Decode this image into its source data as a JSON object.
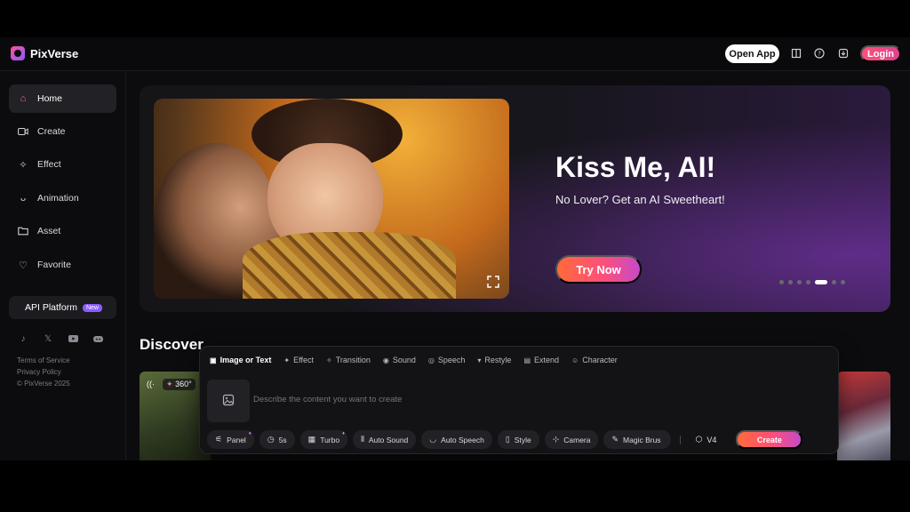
{
  "app": {
    "name": "PixVerse"
  },
  "header": {
    "open_app": "Open App",
    "login": "Login",
    "icons": [
      "book-icon",
      "help-icon",
      "download-icon"
    ]
  },
  "sidebar": {
    "items": [
      {
        "label": "Home",
        "icon": "home-icon",
        "active": true
      },
      {
        "label": "Create",
        "icon": "video-icon"
      },
      {
        "label": "Effect",
        "icon": "sparkle-icon"
      },
      {
        "label": "Animation",
        "icon": "animation-icon"
      },
      {
        "label": "Asset",
        "icon": "folder-icon"
      },
      {
        "label": "Favorite",
        "icon": "heart-icon"
      }
    ],
    "api_platform": {
      "label": "API Platform",
      "badge": "New"
    },
    "socials": [
      "tiktok-icon",
      "x-icon",
      "youtube-icon",
      "discord-icon"
    ],
    "footer": {
      "terms": "Terms of Service",
      "privacy": "Privacy Policy",
      "copyright": "© PixVerse 2025"
    }
  },
  "hero": {
    "title": "Kiss Me, AI!",
    "subtitle": "No Lover? Get an AI Sweetheart!",
    "cta": "Try Now",
    "carousel_count": 7,
    "carousel_active": 4
  },
  "discover": {
    "title": "Discover",
    "first_card_badge": "360°"
  },
  "create_panel": {
    "tabs": [
      {
        "label": "Image or Text",
        "active": true
      },
      {
        "label": "Effect"
      },
      {
        "label": "Transition"
      },
      {
        "label": "Sound"
      },
      {
        "label": "Speech"
      },
      {
        "label": "Restyle"
      },
      {
        "label": "Extend"
      },
      {
        "label": "Character"
      }
    ],
    "prompt_placeholder": "Describe the content you want to create",
    "tools": {
      "panel": "Panel",
      "duration": "5s",
      "turbo": "Turbo",
      "auto_sound": "Auto Sound",
      "auto_speech": "Auto Speech",
      "style": "Style",
      "camera": "Camera",
      "magic_brush": "Magic Brus"
    },
    "model": "V4",
    "create": "Create"
  },
  "colors": {
    "accent_pink": "#ff4f7a",
    "accent_purple": "#8a5cff",
    "background": "#0c0c0e"
  }
}
